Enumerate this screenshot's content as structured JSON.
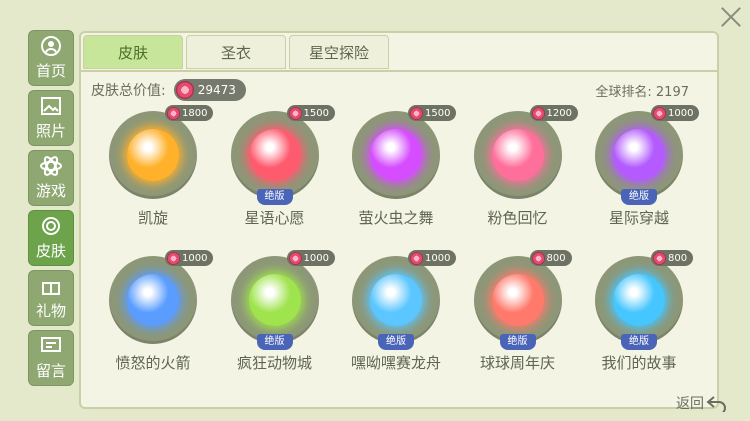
{
  "sidebar": {
    "items": [
      {
        "label": "首页",
        "icon": "home-icon"
      },
      {
        "label": "照片",
        "icon": "photo-icon"
      },
      {
        "label": "游戏",
        "icon": "atom-icon"
      },
      {
        "label": "皮肤",
        "icon": "skin-icon",
        "active": true
      },
      {
        "label": "礼物",
        "icon": "gift-icon"
      },
      {
        "label": "留言",
        "icon": "message-icon"
      }
    ]
  },
  "tabs": [
    {
      "label": "皮肤",
      "active": true
    },
    {
      "label": "圣衣"
    },
    {
      "label": "星空探险"
    }
  ],
  "summary": {
    "label": "皮肤总价值:",
    "value": "29473",
    "ranking": "全球排名: 2197"
  },
  "skins": [
    {
      "name": "凯旋",
      "price": "1800",
      "badge": "",
      "color": "#ffb12b"
    },
    {
      "name": "星语心愿",
      "price": "1500",
      "badge": "绝版",
      "color": "#ff5b6e"
    },
    {
      "name": "萤火虫之舞",
      "price": "1500",
      "badge": "",
      "color": "#d64cff"
    },
    {
      "name": "粉色回忆",
      "price": "1200",
      "badge": "",
      "color": "#ff6f9b"
    },
    {
      "name": "星际穿越",
      "price": "1000",
      "badge": "绝版",
      "color": "#b35bff"
    },
    {
      "name": "愤怒的火箭",
      "price": "1000",
      "badge": "",
      "color": "#5a9dff"
    },
    {
      "name": "疯狂动物城",
      "price": "1000",
      "badge": "绝版",
      "color": "#9fe34d"
    },
    {
      "name": "嘿呦嘿赛龙舟",
      "price": "1000",
      "badge": "绝版",
      "color": "#5bc6ff"
    },
    {
      "name": "球球周年庆",
      "price": "800",
      "badge": "绝版",
      "color": "#ff7a6b"
    },
    {
      "name": "我们的故事",
      "price": "800",
      "badge": "绝版",
      "color": "#46c6ff"
    }
  ],
  "back": {
    "label": "返回"
  }
}
